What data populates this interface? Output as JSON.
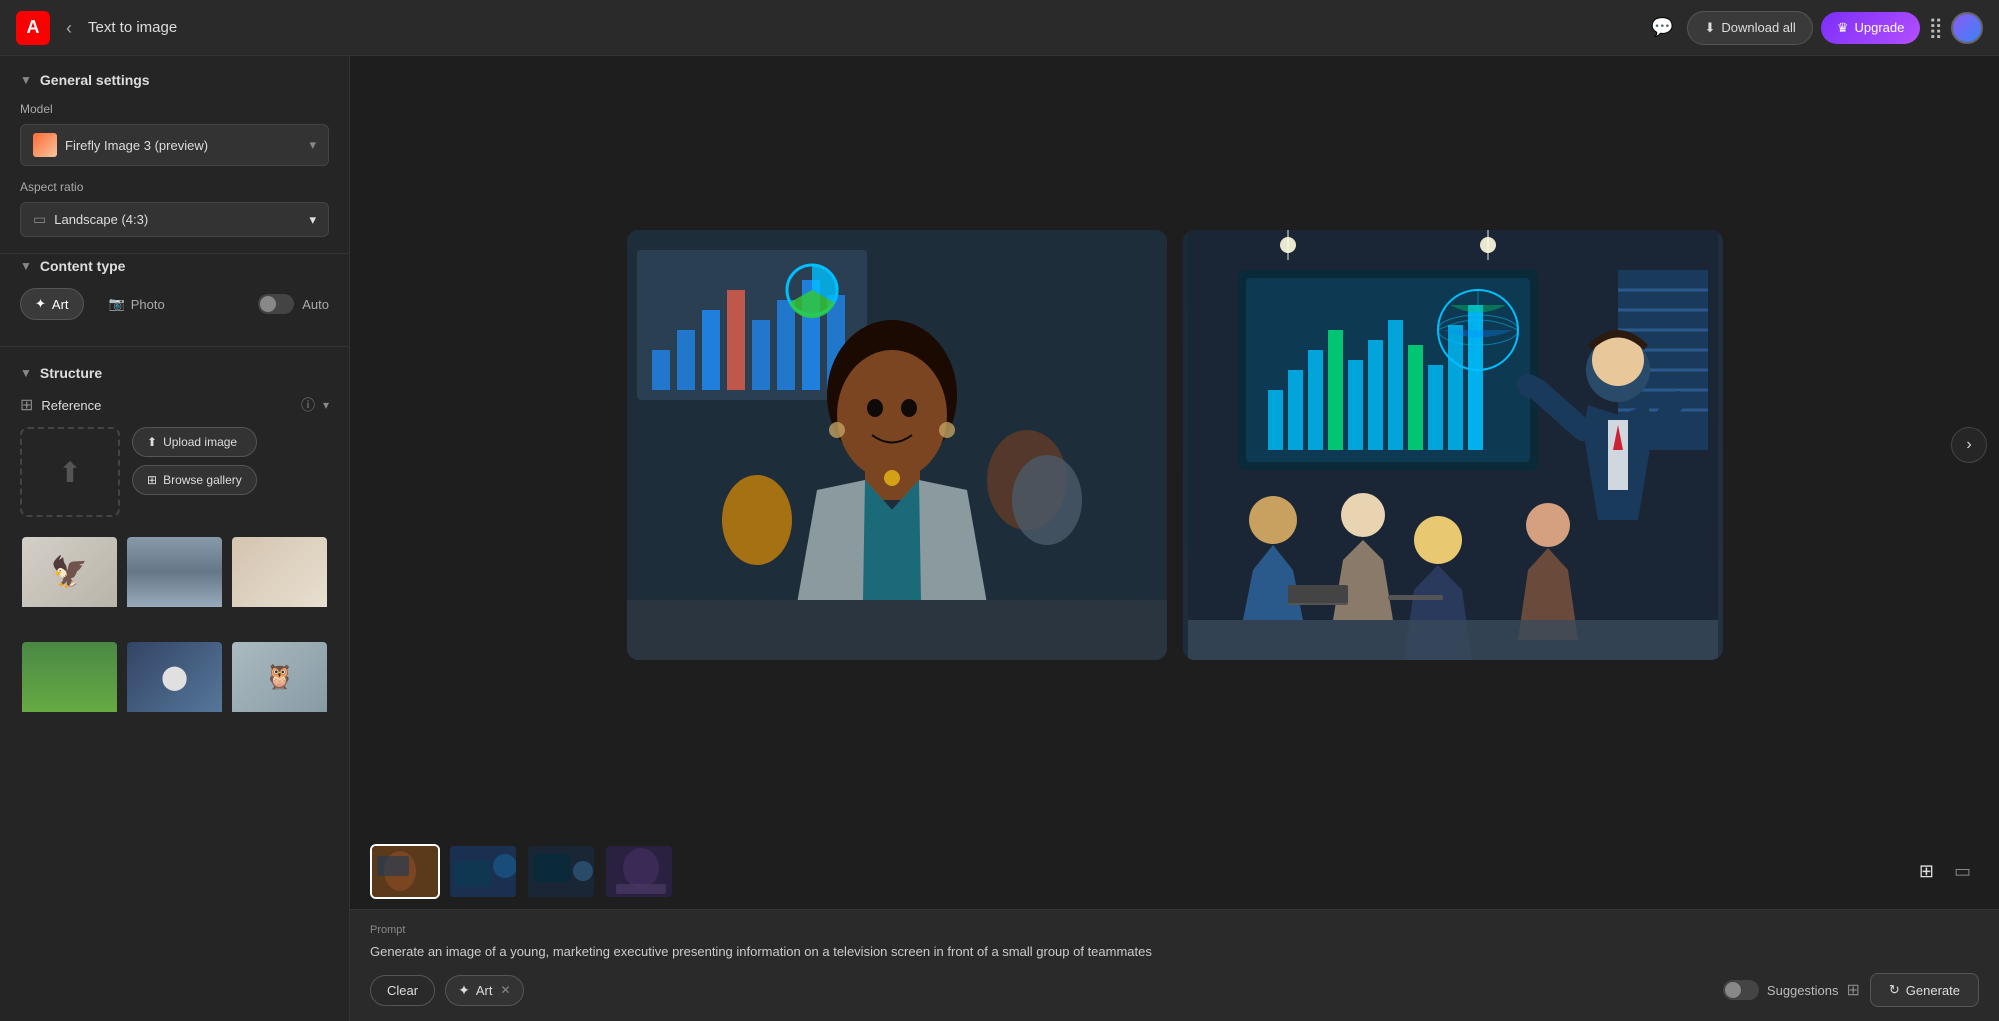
{
  "topbar": {
    "logo": "A",
    "back_label": "‹",
    "title": "Text to image",
    "download_all_label": "Download all",
    "upgrade_label": "Upgrade",
    "crown_icon": "♛",
    "download_icon": "⬇",
    "message_icon": "💬",
    "apps_icon": "⣿"
  },
  "left_panel": {
    "general_settings_label": "General settings",
    "model_label": "Model",
    "model_name": "Firefly Image 3 (preview)",
    "aspect_ratio_label": "Aspect ratio",
    "aspect_ratio_value": "Landscape (4:3)",
    "content_type_label": "Content type",
    "content_btn_art": "Art",
    "content_btn_photo": "Photo",
    "content_auto_label": "Auto",
    "structure_label": "Structure",
    "reference_label": "Reference",
    "upload_image_label": "Upload image",
    "browse_gallery_label": "Browse gallery",
    "browse_gallery_icon": "088"
  },
  "main": {
    "nav_right_icon": "›",
    "prompt_label": "Prompt",
    "prompt_text": "Generate an image of a young, marketing executive presenting information on a television screen in front of a small group of teammates",
    "clear_label": "Clear",
    "art_tag_label": "Art",
    "suggestions_label": "Suggestions",
    "generate_label": "Generate",
    "generate_icon": "↻"
  },
  "thumbnails": [
    {
      "id": "thumb-1",
      "active": true
    },
    {
      "id": "thumb-2",
      "active": false
    },
    {
      "id": "thumb-3",
      "active": false
    },
    {
      "id": "thumb-4",
      "active": false
    }
  ]
}
